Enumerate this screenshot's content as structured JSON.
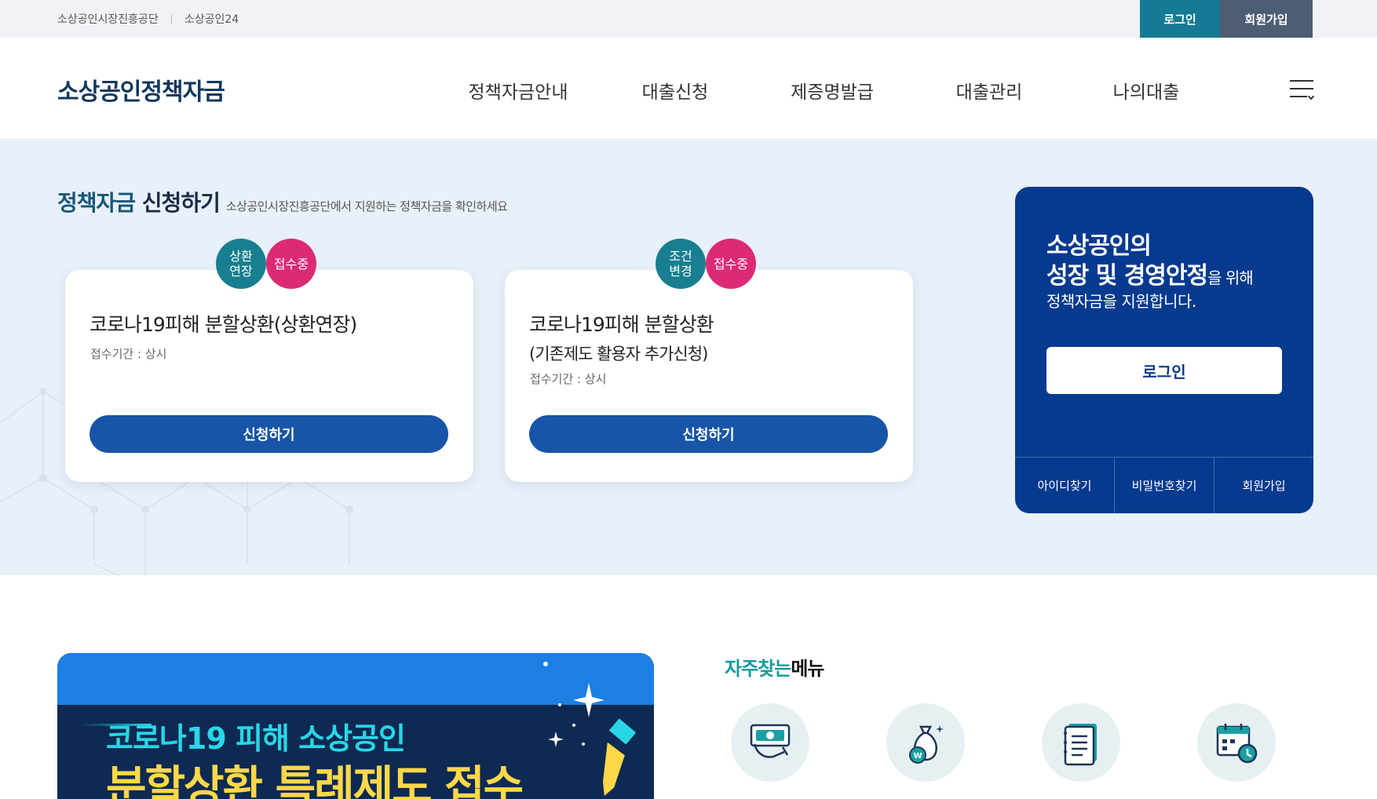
{
  "topbar": {
    "link1": "소상공인시장진흥공단",
    "link2": "소상공인24",
    "login": "로그인",
    "join": "회원가입"
  },
  "header": {
    "logo": "소상공인정책자금",
    "nav": [
      "정책자금안내",
      "대출신청",
      "제증명발급",
      "대출관리",
      "나의대출"
    ],
    "menu_icon": "hamburger-icon"
  },
  "hero": {
    "title_accent": "정책자금",
    "title_rest": " 신청하기",
    "subtitle": "소상공인시장진흥공단에서 지원하는 정책자금을 확인하세요",
    "cards": [
      {
        "badge1": "상환\n연장",
        "badge2": "접수중",
        "title_line1": "코로나19피해 분할상환(상환연장)",
        "title_line2": "",
        "period": "접수기간 : 상시",
        "button": "신청하기"
      },
      {
        "badge1": "조건\n변경",
        "badge2": "접수중",
        "title_line1": "코로나19피해 분할상환",
        "title_line2": "(기존제도 활용자 추가신청)",
        "period": "접수기간 : 상시",
        "button": "신청하기"
      }
    ],
    "login_box": {
      "line1": "소상공인의",
      "line2_bold": "성장 및 경영안정",
      "line2_small": "을 위해",
      "line3": "정책자금을 지원합니다.",
      "button": "로그인",
      "links": [
        "아이디찾기",
        "비밀번호찾기",
        "회원가입"
      ]
    }
  },
  "banner": {
    "line1": "코로나19 피해 소상공인",
    "line2": "분할상환 특례제도 접수"
  },
  "quick": {
    "title_accent": "자주찾는",
    "title_rest": "메뉴",
    "icons": [
      "money-hand-icon",
      "money-bag-icon",
      "document-icon",
      "calendar-clock-icon"
    ]
  },
  "colors": {
    "primary_blue": "#1855a8",
    "navy": "#053a8f",
    "teal": "#177f8f",
    "pink": "#dd2a76"
  }
}
